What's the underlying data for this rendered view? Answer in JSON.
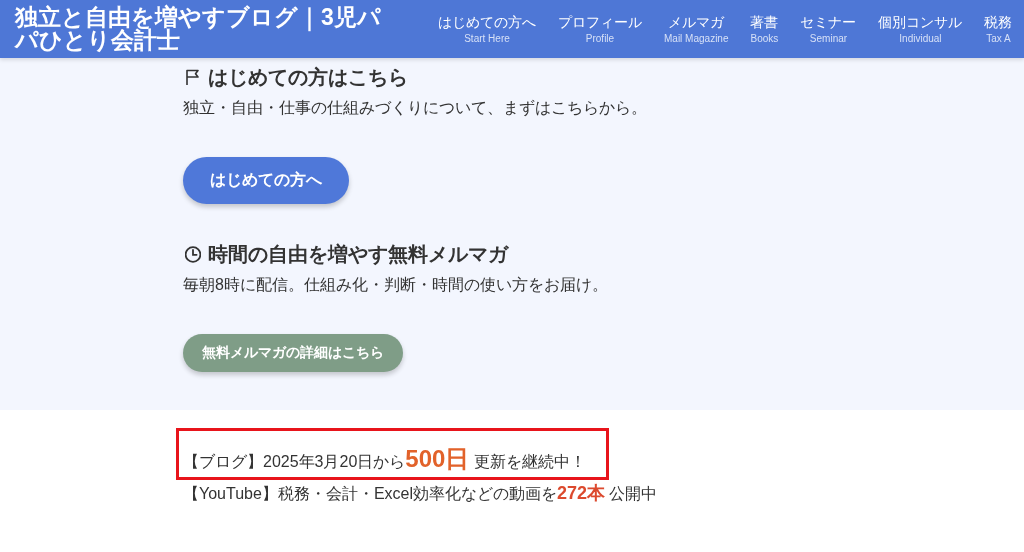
{
  "header": {
    "site_title": "独立と自由を増やすブログ｜3児パパひとり会計士",
    "nav": [
      {
        "label": "はじめての方へ",
        "sublabel": "Start Here"
      },
      {
        "label": "プロフィール",
        "sublabel": "Profile"
      },
      {
        "label": "メルマガ",
        "sublabel": "Mail Magazine"
      },
      {
        "label": "著書",
        "sublabel": "Books"
      },
      {
        "label": "セミナー",
        "sublabel": "Seminar"
      },
      {
        "label": "個別コンサル",
        "sublabel": "Individual"
      },
      {
        "label": "税務",
        "sublabel": "Tax A"
      }
    ]
  },
  "sections": [
    {
      "kind": "start",
      "heading": "はじめての方はこちら",
      "text": "独立・自由・仕事の仕組みづくりについて、まずはこちらから。",
      "button": "はじめての方へ"
    },
    {
      "kind": "newsletter",
      "heading": "時間の自由を増やす無料メルマガ",
      "text": "毎朝8時に配信。仕組み化・判断・時間の使い方をお届け。",
      "button": "無料メルマガの詳細はこちら"
    }
  ],
  "stats": [
    {
      "kind": "blog",
      "text": "【ブログ】2025年3月20日から**500日** 更新を継続中！",
      "highlighted": true
    },
    {
      "kind": "youtube",
      "text": "【YouTube】税務・会計・Excel効率化などの動画を**272本** 公開中",
      "highlighted": false
    }
  ]
}
